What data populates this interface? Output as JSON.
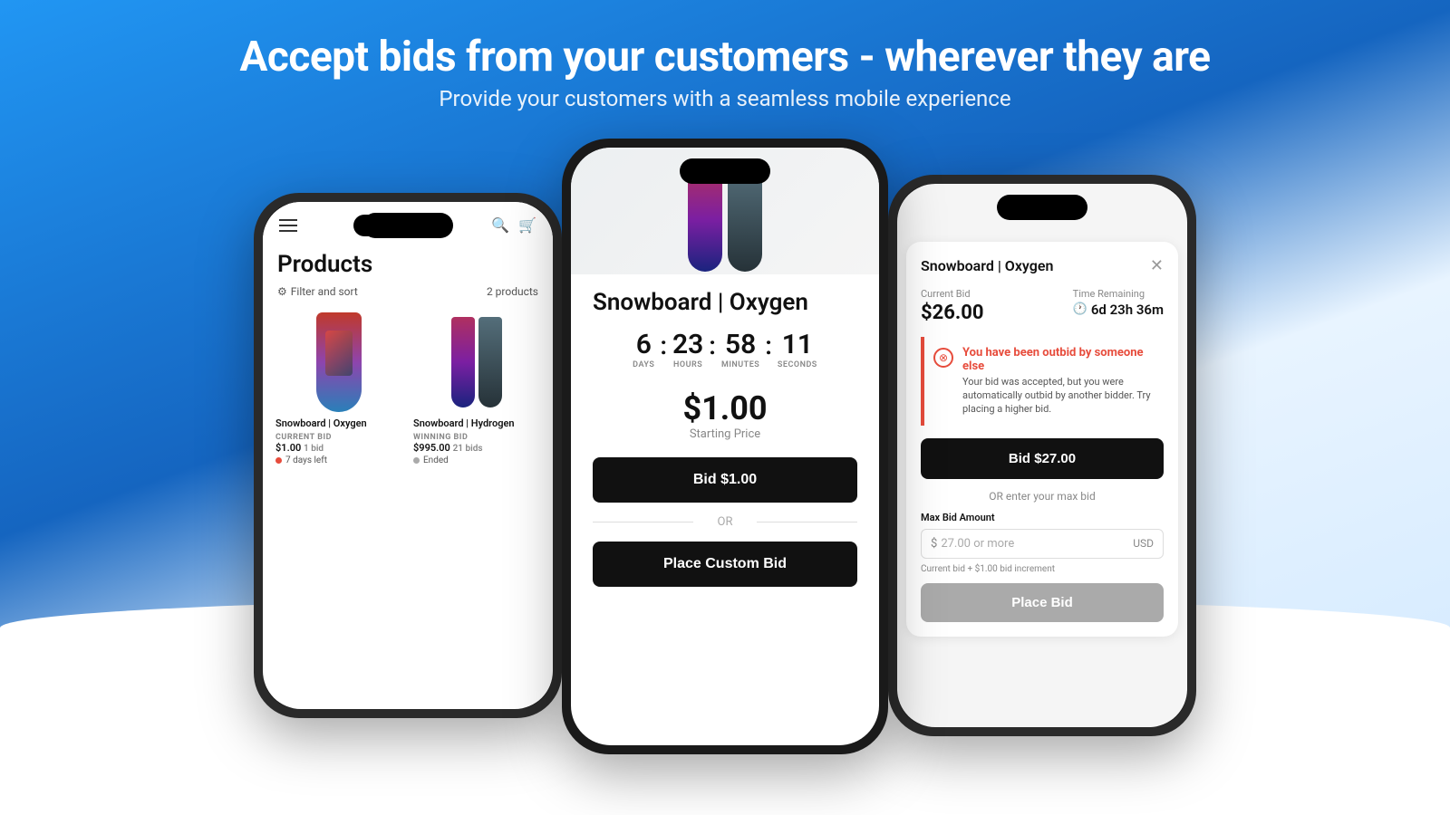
{
  "header": {
    "title": "Accept bids from your customers - wherever they are",
    "subtitle": "Provide your customers with a seamless mobile experience"
  },
  "left_phone": {
    "page_title": "Products",
    "filter_label": "Filter and sort",
    "product_count": "2 products",
    "products": [
      {
        "name": "Snowboard | Oxygen",
        "bid_label": "CURRENT BID",
        "bid_value": "$1.00",
        "bid_count": "1 bid",
        "status": "7 days left",
        "status_type": "active"
      },
      {
        "name": "Snowboard | Hydrogen",
        "bid_label": "WINNING BID",
        "bid_value": "$995.00",
        "bid_count": "21 bids",
        "status": "Ended",
        "status_type": "ended"
      }
    ]
  },
  "center_phone": {
    "product_title": "Snowboard | Oxygen",
    "countdown": {
      "days": "6",
      "hours": "23",
      "minutes": "58",
      "seconds": "11",
      "days_label": "DAYS",
      "hours_label": "HOURS",
      "minutes_label": "MINUTES",
      "seconds_label": "SECONDS"
    },
    "starting_price": "$1.00",
    "starting_price_label": "Starting Price",
    "bid_button": "Bid $1.00",
    "or_label": "OR",
    "custom_bid_button": "Place Custom Bid"
  },
  "right_phone": {
    "modal_title": "Snowboard | Oxygen",
    "close_icon": "✕",
    "current_bid_label": "Current Bid",
    "current_bid_value": "$26.00",
    "time_remaining_label": "Time Remaining",
    "time_remaining_value": "6d 23h 36m",
    "outbid_title": "You have been outbid by someone else",
    "outbid_body": "Your bid was accepted, but you were automatically outbid by another bidder. Try placing a higher bid.",
    "bid_next_button": "Bid $27.00",
    "or_enter_label": "OR enter your max bid",
    "max_bid_label": "Max Bid Amount",
    "input_placeholder": "27.00 or more",
    "currency_symbol": "$",
    "currency_code": "USD",
    "increment_note": "Current bid + $1.00 bid increment",
    "place_bid_button": "Place Bid"
  }
}
